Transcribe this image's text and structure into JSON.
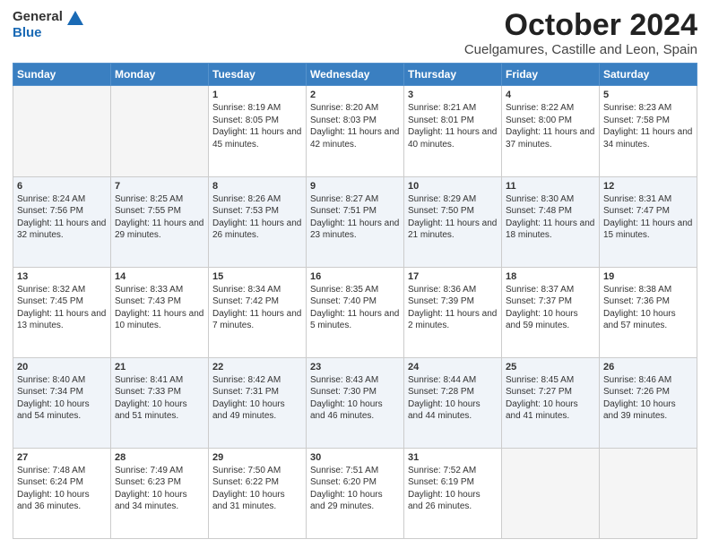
{
  "header": {
    "logo_general": "General",
    "logo_blue": "Blue",
    "title": "October 2024",
    "location": "Cuelgamures, Castille and Leon, Spain"
  },
  "days_of_week": [
    "Sunday",
    "Monday",
    "Tuesday",
    "Wednesday",
    "Thursday",
    "Friday",
    "Saturday"
  ],
  "weeks": [
    [
      {
        "day": "",
        "info": ""
      },
      {
        "day": "",
        "info": ""
      },
      {
        "day": "1",
        "info": "Sunrise: 8:19 AM\nSunset: 8:05 PM\nDaylight: 11 hours and 45 minutes."
      },
      {
        "day": "2",
        "info": "Sunrise: 8:20 AM\nSunset: 8:03 PM\nDaylight: 11 hours and 42 minutes."
      },
      {
        "day": "3",
        "info": "Sunrise: 8:21 AM\nSunset: 8:01 PM\nDaylight: 11 hours and 40 minutes."
      },
      {
        "day": "4",
        "info": "Sunrise: 8:22 AM\nSunset: 8:00 PM\nDaylight: 11 hours and 37 minutes."
      },
      {
        "day": "5",
        "info": "Sunrise: 8:23 AM\nSunset: 7:58 PM\nDaylight: 11 hours and 34 minutes."
      }
    ],
    [
      {
        "day": "6",
        "info": "Sunrise: 8:24 AM\nSunset: 7:56 PM\nDaylight: 11 hours and 32 minutes."
      },
      {
        "day": "7",
        "info": "Sunrise: 8:25 AM\nSunset: 7:55 PM\nDaylight: 11 hours and 29 minutes."
      },
      {
        "day": "8",
        "info": "Sunrise: 8:26 AM\nSunset: 7:53 PM\nDaylight: 11 hours and 26 minutes."
      },
      {
        "day": "9",
        "info": "Sunrise: 8:27 AM\nSunset: 7:51 PM\nDaylight: 11 hours and 23 minutes."
      },
      {
        "day": "10",
        "info": "Sunrise: 8:29 AM\nSunset: 7:50 PM\nDaylight: 11 hours and 21 minutes."
      },
      {
        "day": "11",
        "info": "Sunrise: 8:30 AM\nSunset: 7:48 PM\nDaylight: 11 hours and 18 minutes."
      },
      {
        "day": "12",
        "info": "Sunrise: 8:31 AM\nSunset: 7:47 PM\nDaylight: 11 hours and 15 minutes."
      }
    ],
    [
      {
        "day": "13",
        "info": "Sunrise: 8:32 AM\nSunset: 7:45 PM\nDaylight: 11 hours and 13 minutes."
      },
      {
        "day": "14",
        "info": "Sunrise: 8:33 AM\nSunset: 7:43 PM\nDaylight: 11 hours and 10 minutes."
      },
      {
        "day": "15",
        "info": "Sunrise: 8:34 AM\nSunset: 7:42 PM\nDaylight: 11 hours and 7 minutes."
      },
      {
        "day": "16",
        "info": "Sunrise: 8:35 AM\nSunset: 7:40 PM\nDaylight: 11 hours and 5 minutes."
      },
      {
        "day": "17",
        "info": "Sunrise: 8:36 AM\nSunset: 7:39 PM\nDaylight: 11 hours and 2 minutes."
      },
      {
        "day": "18",
        "info": "Sunrise: 8:37 AM\nSunset: 7:37 PM\nDaylight: 10 hours and 59 minutes."
      },
      {
        "day": "19",
        "info": "Sunrise: 8:38 AM\nSunset: 7:36 PM\nDaylight: 10 hours and 57 minutes."
      }
    ],
    [
      {
        "day": "20",
        "info": "Sunrise: 8:40 AM\nSunset: 7:34 PM\nDaylight: 10 hours and 54 minutes."
      },
      {
        "day": "21",
        "info": "Sunrise: 8:41 AM\nSunset: 7:33 PM\nDaylight: 10 hours and 51 minutes."
      },
      {
        "day": "22",
        "info": "Sunrise: 8:42 AM\nSunset: 7:31 PM\nDaylight: 10 hours and 49 minutes."
      },
      {
        "day": "23",
        "info": "Sunrise: 8:43 AM\nSunset: 7:30 PM\nDaylight: 10 hours and 46 minutes."
      },
      {
        "day": "24",
        "info": "Sunrise: 8:44 AM\nSunset: 7:28 PM\nDaylight: 10 hours and 44 minutes."
      },
      {
        "day": "25",
        "info": "Sunrise: 8:45 AM\nSunset: 7:27 PM\nDaylight: 10 hours and 41 minutes."
      },
      {
        "day": "26",
        "info": "Sunrise: 8:46 AM\nSunset: 7:26 PM\nDaylight: 10 hours and 39 minutes."
      }
    ],
    [
      {
        "day": "27",
        "info": "Sunrise: 7:48 AM\nSunset: 6:24 PM\nDaylight: 10 hours and 36 minutes."
      },
      {
        "day": "28",
        "info": "Sunrise: 7:49 AM\nSunset: 6:23 PM\nDaylight: 10 hours and 34 minutes."
      },
      {
        "day": "29",
        "info": "Sunrise: 7:50 AM\nSunset: 6:22 PM\nDaylight: 10 hours and 31 minutes."
      },
      {
        "day": "30",
        "info": "Sunrise: 7:51 AM\nSunset: 6:20 PM\nDaylight: 10 hours and 29 minutes."
      },
      {
        "day": "31",
        "info": "Sunrise: 7:52 AM\nSunset: 6:19 PM\nDaylight: 10 hours and 26 minutes."
      },
      {
        "day": "",
        "info": ""
      },
      {
        "day": "",
        "info": ""
      }
    ]
  ]
}
